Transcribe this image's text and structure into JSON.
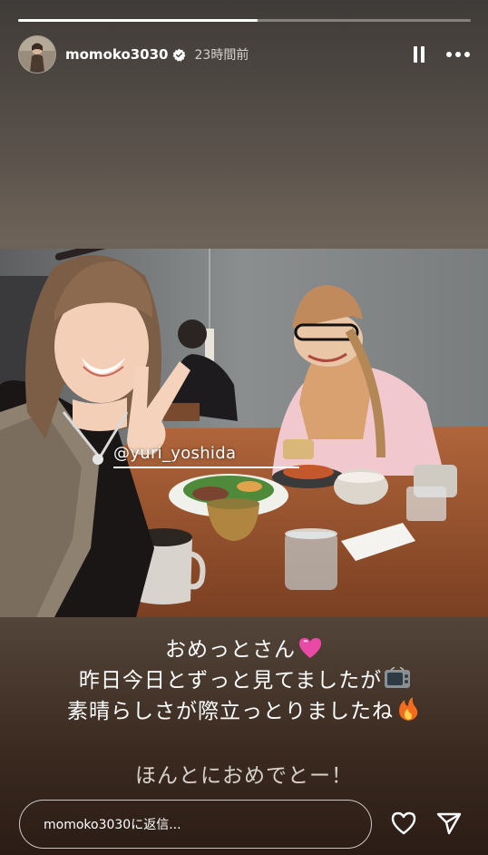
{
  "story": {
    "progress": 0.53,
    "username": "momoko3030",
    "verified": true,
    "time_ago": "23時間前"
  },
  "mention_tag": "@yuri_yoshida",
  "caption": {
    "line1": "おめっとさん",
    "line1_emoji": "pink-heart",
    "line2": "昨日今日とずっと見てましたが",
    "line2_emoji": "television",
    "line3": "素晴らしさが際立っとりましたね",
    "line3_emoji": "fire",
    "line4": "ほんとにおめでとー！"
  },
  "reply": {
    "placeholder": "momoko3030に返信..."
  },
  "colors": {
    "background_top": "#4a4440",
    "background_bottom": "#2b1c15",
    "heart_emoji": "#e94aa6",
    "fire_emoji": "#f36b1c"
  }
}
